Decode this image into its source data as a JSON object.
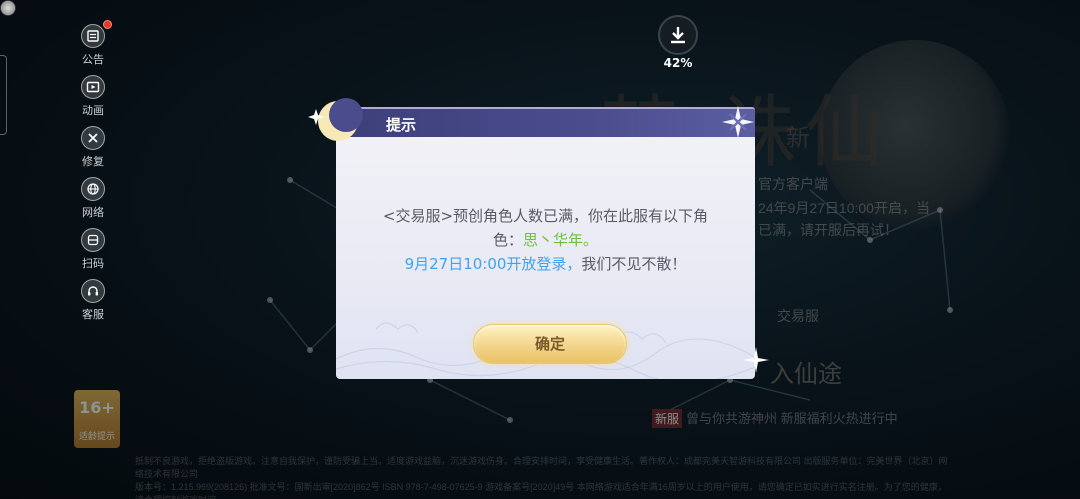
{
  "sidebar": {
    "items": [
      {
        "label": "公告",
        "icon": "notice-icon",
        "badge": true
      },
      {
        "label": "动画",
        "icon": "video-icon"
      },
      {
        "label": "修复",
        "icon": "repair-icon"
      },
      {
        "label": "网络",
        "icon": "network-icon"
      },
      {
        "label": "扫码",
        "icon": "scan-icon"
      },
      {
        "label": "客服",
        "icon": "headset-icon"
      }
    ]
  },
  "age_rating": {
    "rating": "16+",
    "label": "适龄提示"
  },
  "download": {
    "percent": "42%",
    "icon": "download-icon"
  },
  "background": {
    "client_text": "官方客户端",
    "announce_line1": "24年9月27日10:00开启，当",
    "announce_line2": "已满，请开服后再试！",
    "server_name": "交易服",
    "enter_text": "入仙途",
    "news_badge": "新服",
    "news_text": "曾与你共游神州     新服福利火热进行中",
    "footer_line1": "抵制不良游戏，拒绝盗版游戏。注意自我保护，谨防受骗上当。适度游戏益脑，沉迷游戏伤身。合理安排时间，享受健康生活。著作权人：成都完美天智游科技有限公司  出版服务单位：完美世界（北京）网络技术有限公司",
    "footer_line2": "版本号：1.215.969(208126)  批准文号：国新出审[2020]862号  ISBN 978-7-498-07625-9  游戏备案号[2020]49号  本网络游戏适合年满16周岁以上的用户使用，请您确定已如实进行实名注册。为了您的健康，请合理控制游戏时间"
  },
  "dialog": {
    "title": "提示",
    "message": {
      "part1": "<交易服>预创角色人数已满，你在此服有以下角",
      "part2": "色：",
      "character": "思丶华年。",
      "time": "9月27日10:00开放登录，",
      "ending": "我们不见不散！"
    },
    "confirm_label": "确定"
  },
  "colors": {
    "accent_green": "#6dc33c",
    "accent_blue": "#3fa3f0",
    "header_purple": "#4a4c8d",
    "button_gold": "#f3d48a"
  }
}
